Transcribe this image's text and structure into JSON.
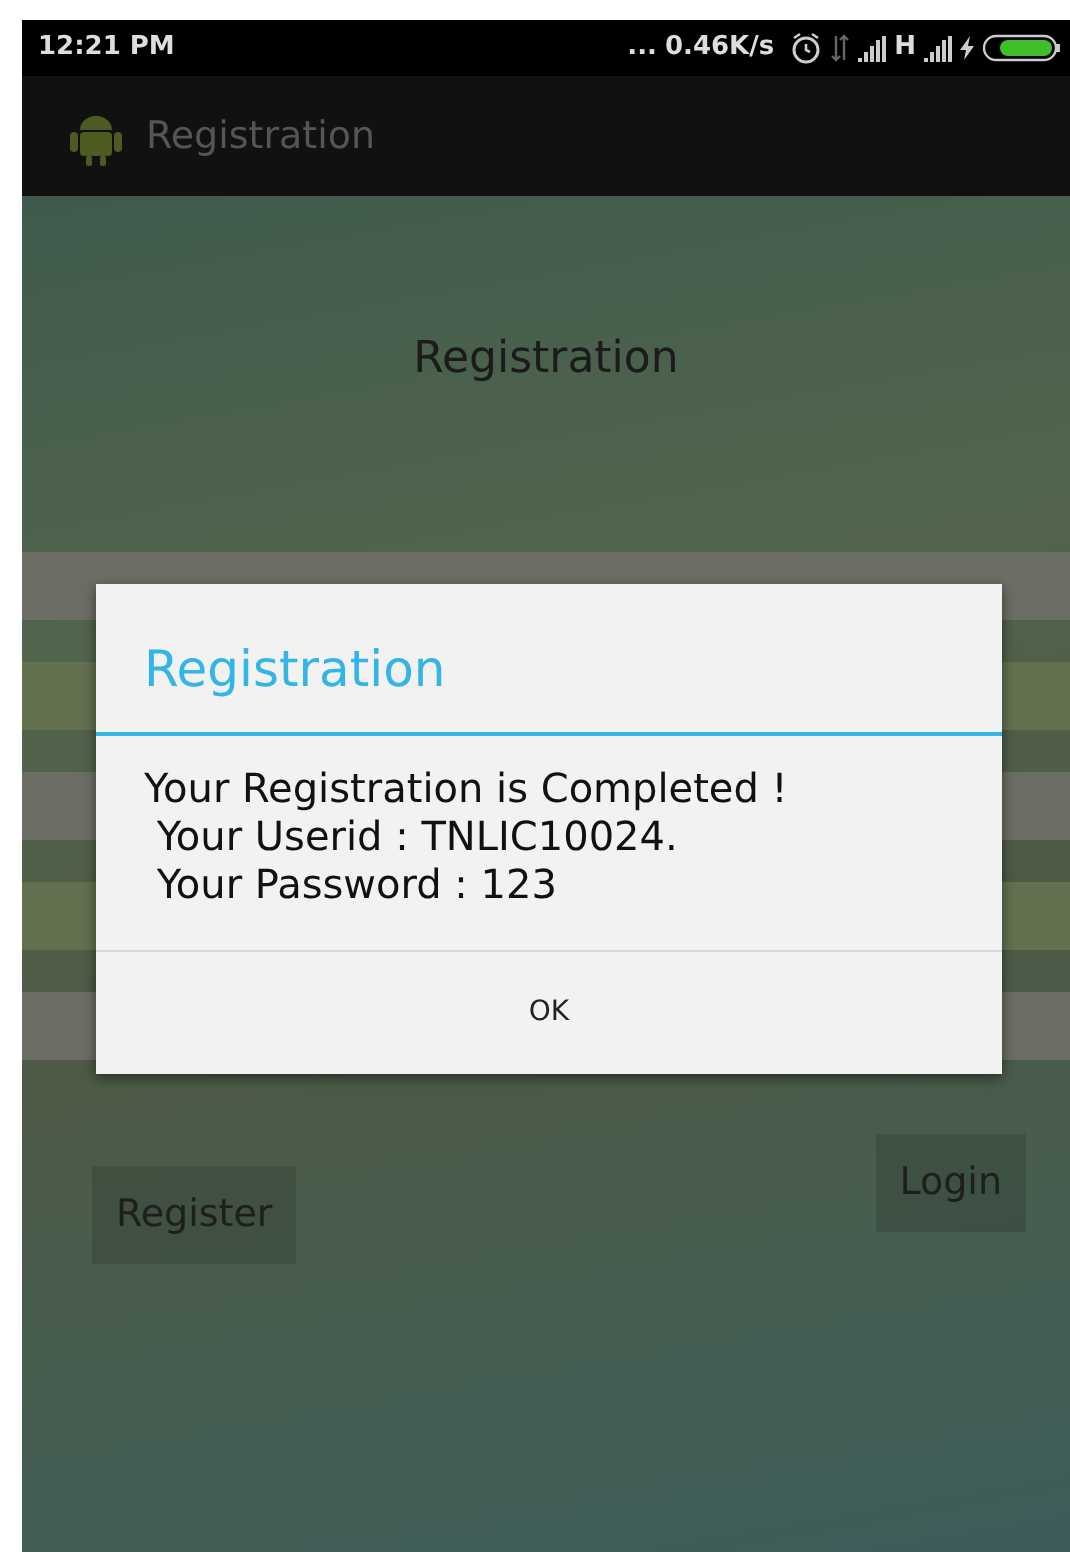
{
  "status_bar": {
    "time": "12:21 PM",
    "more": "...",
    "speed": "0.46K/s",
    "network_type": "H"
  },
  "action_bar": {
    "title": "Registration"
  },
  "screen": {
    "heading": "Registration",
    "buttons": [
      {
        "label": "Register"
      },
      {
        "label": "Login"
      }
    ]
  },
  "dialog": {
    "title": "Registration",
    "message": "Your Registration is Completed !\n Your Userid : TNLIC10024.\n Your Password : 123",
    "buttons": [
      "OK"
    ]
  }
}
